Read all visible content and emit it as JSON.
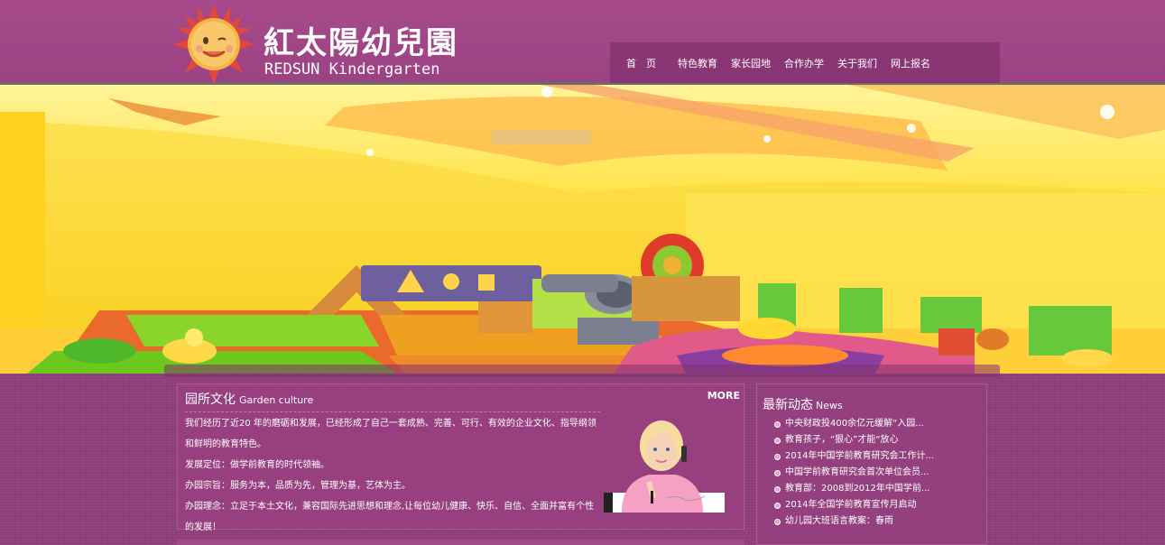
{
  "header": {
    "logo_cn": "紅太陽幼兒園",
    "logo_en": "REDSUN Kindergarten"
  },
  "nav": {
    "items": [
      {
        "label": "首　页"
      },
      {
        "label": "特色教育"
      },
      {
        "label": "家长园地"
      },
      {
        "label": "合作办学"
      },
      {
        "label": "关于我们"
      },
      {
        "label": "网上报名"
      }
    ]
  },
  "banner": {
    "slide_count": 4,
    "active_slide": 4
  },
  "culture": {
    "title": "园所文化",
    "title_en": "Garden culture",
    "more": "MORE",
    "paragraphs": [
      "我们经历了近20 年的磨砺和发展，已经形成了自己一套成熟、完善、可行、有效的企业文化、指导纲领和鲜明的教育特色。",
      "发展定位：做学前教育的时代领袖。",
      "办园宗旨：服务为本，品质为先，管理为基，艺体为主。",
      "办园理念：立足于本土文化，兼容国际先进思想和理念,让每位幼儿健康、快乐、自信、全面并富有个性的发展！"
    ]
  },
  "news": {
    "title": "最新动态",
    "title_en": "News",
    "items": [
      "中央财政投400余亿元缓解“入园...",
      "教育孩子，“狠心”才能“放心",
      "2014年中国学前教育研究会工作计...",
      "中国学前教育研究会首次单位会员...",
      "教育部：2008到2012年中国学前...",
      "2014年全国学前教育宣传月启动",
      "幼儿园大班语言教案：春雨"
    ]
  },
  "colors": {
    "header": "#a64a8b",
    "nav": "#8a3574",
    "content": "#8d3c77",
    "active_dot": "#8a2f8d"
  }
}
